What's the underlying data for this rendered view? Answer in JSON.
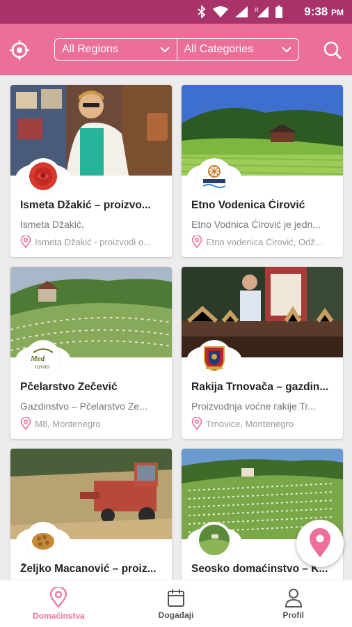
{
  "status": {
    "time": "9:38",
    "ampm": "PM",
    "icons": [
      "bluetooth-icon",
      "wifi-icon",
      "signal-icon",
      "r-signal-icon",
      "battery-icon"
    ]
  },
  "appbar": {
    "locate_icon": "crosshair-icon",
    "search_icon": "search-icon",
    "region_filter": "All Regions",
    "category_filter": "All Categories"
  },
  "cards": [
    {
      "title": "Ismeta Džakić – proizvo...",
      "subtitle": "Ismeta Džakić,",
      "location": "Ismeta Džakić - proizvodi o..."
    },
    {
      "title": "Etno Vodenica Ćirović",
      "subtitle": "Etno Vodnica Ćirović je jedn...",
      "location": "Etno vodenica Ćirović, Odž..."
    },
    {
      "title": "Pčelarstvo Zečević",
      "subtitle": "Gazdinstvo – Pčelarstvo Ze...",
      "location": "M8, Montenegro"
    },
    {
      "title": "Rakija Trnovača – gazdin...",
      "subtitle": "Proizvodnja voćne rakije Tr...",
      "location": "Trnovice, Montenegro"
    },
    {
      "title": "Željko Macanović – proiz...",
      "subtitle": "",
      "location": ""
    },
    {
      "title": "Seosko domaćinstvo – K...",
      "subtitle": "",
      "location": ""
    }
  ],
  "nav": {
    "items": [
      {
        "label": "Domaćinstva",
        "icon": "map-pin-icon",
        "active": true
      },
      {
        "label": "Događaji",
        "icon": "calendar-icon",
        "active": false
      },
      {
        "label": "Profil",
        "icon": "person-icon",
        "active": false
      }
    ]
  },
  "fab_icon": "map-pin-icon",
  "colors": {
    "primary": "#ec6f9b",
    "statusbar": "#a8336a"
  }
}
